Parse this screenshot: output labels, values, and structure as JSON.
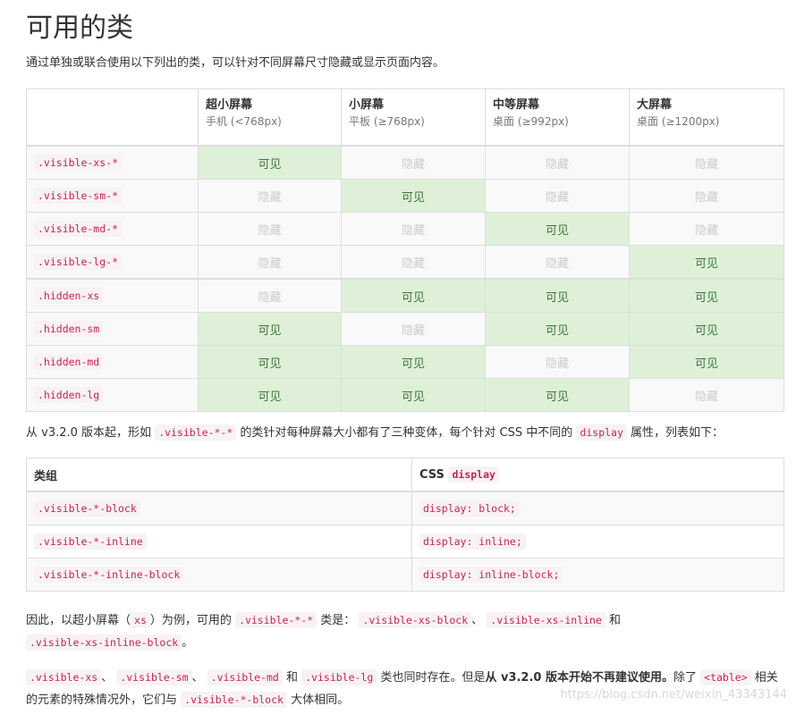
{
  "heading": "可用的类",
  "intro": "通过单独或联合使用以下列出的类，可以针对不同屏幕尺寸隐藏或显示页面内容。",
  "vis_table": {
    "headers": [
      {
        "title": "超小屏幕",
        "sub": "手机 (<768px)"
      },
      {
        "title": "小屏幕",
        "sub": "平板 (≥768px)"
      },
      {
        "title": "中等屏幕",
        "sub": "桌面 (≥992px)"
      },
      {
        "title": "大屏幕",
        "sub": "桌面 (≥1200px)"
      }
    ],
    "visible_text": "可见",
    "hidden_text": "隐藏",
    "rows": [
      {
        "cls": ".visible-xs-*",
        "cells": [
          "可见",
          "隐藏",
          "隐藏",
          "隐藏"
        ]
      },
      {
        "cls": ".visible-sm-*",
        "cells": [
          "隐藏",
          "可见",
          "隐藏",
          "隐藏"
        ]
      },
      {
        "cls": ".visible-md-*",
        "cells": [
          "隐藏",
          "隐藏",
          "可见",
          "隐藏"
        ]
      },
      {
        "cls": ".visible-lg-*",
        "cells": [
          "隐藏",
          "隐藏",
          "隐藏",
          "可见"
        ]
      },
      {
        "cls": ".hidden-xs",
        "cells": [
          "隐藏",
          "可见",
          "可见",
          "可见"
        ]
      },
      {
        "cls": ".hidden-sm",
        "cells": [
          "可见",
          "隐藏",
          "可见",
          "可见"
        ]
      },
      {
        "cls": ".hidden-md",
        "cells": [
          "可见",
          "可见",
          "隐藏",
          "可见"
        ]
      },
      {
        "cls": ".hidden-lg",
        "cells": [
          "可见",
          "可见",
          "可见",
          "隐藏"
        ]
      }
    ]
  },
  "p2": {
    "t1": "从 v3.2.0 版本起，形如",
    "c1": ".visible-*-*",
    "t2": "的类针对每种屏幕大小都有了三种变体，每个针对 CSS 中不同的",
    "c2": "display",
    "t3": "属性，列表如下："
  },
  "disp_table": {
    "h1": "类组",
    "h2_text": "CSS",
    "h2_code": "display",
    "rows": [
      {
        "group": ".visible-*-block",
        "css": "display: block;"
      },
      {
        "group": ".visible-*-inline",
        "css": "display: inline;"
      },
      {
        "group": ".visible-*-inline-block",
        "css": "display: inline-block;"
      }
    ]
  },
  "p3": {
    "t1": "因此，以超小屏幕（",
    "c1": "xs",
    "t2": "）为例，可用的",
    "c2": ".visible-*-*",
    "t3": "类是：",
    "c3": ".visible-xs-block",
    "t4": "、",
    "c4": ".visible-xs-inline",
    "t5": "和",
    "c5": ".visible-xs-inline-block",
    "t6": "。"
  },
  "p4": {
    "c1": ".visible-xs",
    "t1": "、",
    "c2": ".visible-sm",
    "t2": "、",
    "c3": ".visible-md",
    "t3": "和",
    "c4": ".visible-lg",
    "t4": "类也同时存在。但是",
    "strong": "从 v3.2.0 版本开始不再建议使用。",
    "t5": "除了",
    "c5": "<table>",
    "t6": "相关的元素的特殊情况外，它们与",
    "c6": ".visible-*-block",
    "t7": "大体相同。"
  },
  "watermark": "https://blog.csdn.net/weixin_43343144"
}
